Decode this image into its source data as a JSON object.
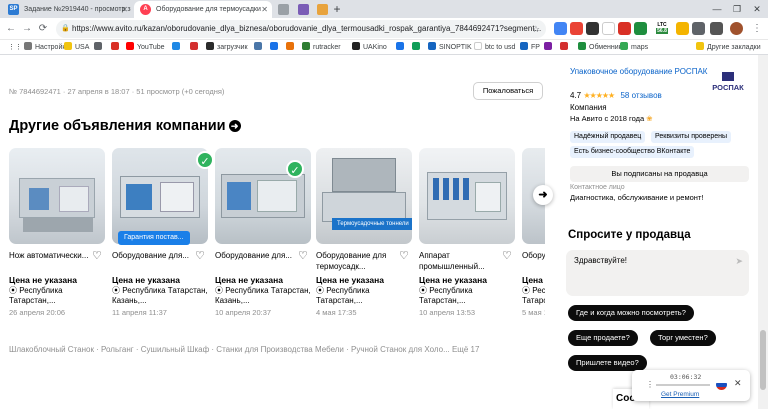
{
  "tabs": [
    {
      "label": "Задание №2919440 - просмотр з",
      "fav": "SP",
      "color": "#2d7bd3"
    },
    {
      "label": "Оборудование для термоусадки",
      "fav": "A",
      "color": "#ff4053"
    },
    {
      "label": "",
      "fav": "",
      "color": "#9aa0a6"
    },
    {
      "label": "",
      "fav": "",
      "color": "#7a5cb6"
    },
    {
      "label": "",
      "fav": "",
      "color": "#e8a33d"
    }
  ],
  "window": {
    "minimize": "—",
    "maximize": "❐",
    "close": "✕",
    "newtab": "+"
  },
  "url": "https://www.avito.ru/kazan/oborudovanie_dlya_biznesa/oborudovanie_dlya_termousadki_rospak_garantiya_7844692471?segment...",
  "ltc": {
    "label": "LTC",
    "value": "56.8"
  },
  "bookmarks": [
    "Настройки",
    "USA",
    "",
    "YouTube",
    "",
    "",
    "загрузчик",
    "",
    "",
    "rutracker",
    "UAKino",
    "",
    "",
    "SINOPTIK",
    "btc to usd",
    "FP",
    "",
    "",
    "Обменник",
    "maps",
    "Другие закладки"
  ],
  "listing_meta": "№ 7844692471 · 27 апреля в 18:07 · 51 просмотр (+0 сегодня)",
  "report_button": "Пожаловаться",
  "section_title": "Другие объявления компании",
  "cards": [
    {
      "title": "Нож автоматически...",
      "price": "Цена не указана",
      "location": "Республика Татарстан,...",
      "date": "26 апреля 20:06"
    },
    {
      "title": "Оборудование для...",
      "price": "Цена не указана",
      "location": "Республика Татарстан, Казань,...",
      "date": "11 апреля 11:37",
      "badge": "Гарантия постав..."
    },
    {
      "title": "Оборудование для...",
      "price": "Цена не указана",
      "location": "Республика Татарстан, Казань,...",
      "date": "10 апреля 20:37"
    },
    {
      "title": "Оборудование для термоусадк...",
      "price": "Цена не указана",
      "location": "Республика Татарстан,...",
      "date": "4 мая 17:35",
      "img_label": "Термоусадочные тоннели"
    },
    {
      "title": "Аппарат промышленный...",
      "price": "Цена не указана",
      "location": "Республика Татарстан,...",
      "date": "10 апреля 13:53"
    },
    {
      "title": "Оборудование для...",
      "price": "Цена не указана",
      "location": "Республика Татарстан,...",
      "date": "5 мая 15:13"
    }
  ],
  "categories_line": "Шлакоблочный Станок · Рольганг · Сушильный Шкаф · Станки для Производства Мебели · Ручной Станок для Холо... Ещё 17",
  "seller": {
    "name": "Упаковочное оборудование РОСПАК",
    "logo": "РОСПАК",
    "rating": "4.7",
    "stars": "★★★★★",
    "reviews": "58 отзывов",
    "type": "Компания",
    "since": "На Авито с 2018 года",
    "tags": [
      "Надёжный продавец",
      "Реквизиты проверены",
      "Есть бизнес-сообщество ВКонтакте"
    ],
    "subscribed": "Вы подписаны на продавца",
    "contact_label": "Контактное лицо",
    "contact_value": "Диагностика, обслуживание и ремонт!"
  },
  "ask": {
    "title": "Спросите у продавца",
    "input_value": "Здравствуйте!",
    "quick": [
      "Где и когда можно посмотреть?",
      "Еще продаете?",
      "Торг уместен?",
      "Пришлете видео?"
    ]
  },
  "player": {
    "time": "03:06:32",
    "link": "Get Premium"
  },
  "chat_stub": "Соо"
}
